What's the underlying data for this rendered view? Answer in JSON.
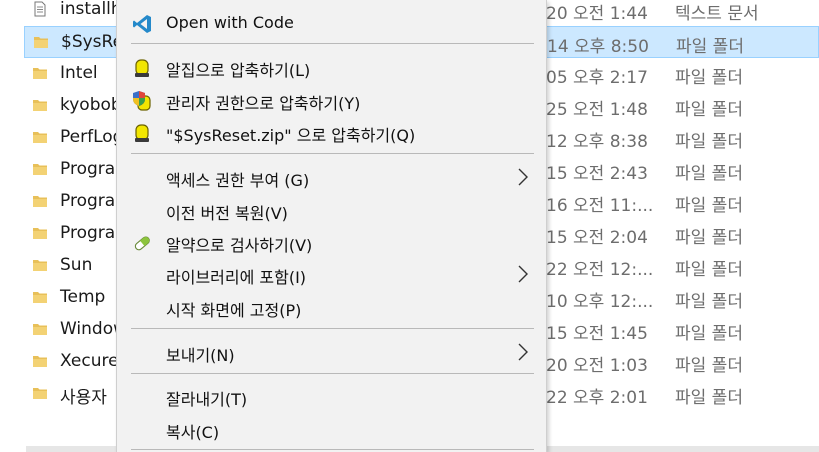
{
  "files": [
    {
      "name": "installh",
      "date": "20 오전 1:44",
      "type": "텍스트 문서",
      "icon": "text-document-icon",
      "selected": false
    },
    {
      "name": "$SysRe",
      "date": "14 오후 8:50",
      "type": "파일 폴더",
      "icon": "folder-icon",
      "selected": true
    },
    {
      "name": "Intel",
      "date": "05 오후 2:17",
      "type": "파일 폴더",
      "icon": "folder-icon",
      "selected": false
    },
    {
      "name": "kyobob",
      "date": "25 오전 1:48",
      "type": "파일 폴더",
      "icon": "folder-icon",
      "selected": false
    },
    {
      "name": "PerfLog",
      "date": "12 오후 8:38",
      "type": "파일 폴더",
      "icon": "folder-icon",
      "selected": false
    },
    {
      "name": "Prograr",
      "date": "15 오전 2:43",
      "type": "파일 폴더",
      "icon": "folder-icon",
      "selected": false
    },
    {
      "name": "Prograr",
      "date": "16 오전 11:...",
      "type": "파일 폴더",
      "icon": "folder-icon",
      "selected": false
    },
    {
      "name": "Prograr",
      "date": "15 오전 2:04",
      "type": "파일 폴더",
      "icon": "folder-icon",
      "selected": false
    },
    {
      "name": "Sun",
      "date": "22 오전 12:...",
      "type": "파일 폴더",
      "icon": "folder-icon",
      "selected": false
    },
    {
      "name": "Temp",
      "date": "10 오후 12:...",
      "type": "파일 폴더",
      "icon": "folder-icon",
      "selected": false
    },
    {
      "name": "Window",
      "date": "15 오전 1:45",
      "type": "파일 폴더",
      "icon": "folder-icon",
      "selected": false
    },
    {
      "name": "Xecure",
      "date": "20 오전 1:03",
      "type": "파일 폴더",
      "icon": "folder-icon",
      "selected": false
    },
    {
      "name": "사용자",
      "date": "22 오후 2:01",
      "type": "파일 폴더",
      "icon": "folder-icon",
      "selected": false
    }
  ],
  "context_menu": {
    "items": [
      {
        "label": "Open with Code",
        "icon": "vscode-icon",
        "submenu": false
      },
      {
        "label": "알집으로 압축하기(L)",
        "icon": "alzip-icon",
        "submenu": false
      },
      {
        "label": "관리자 권한으로 압축하기(Y)",
        "icon": "shield-icon",
        "submenu": false
      },
      {
        "label": "\"$SysReset.zip\" 으로 압축하기(Q)",
        "icon": "alzip-icon",
        "submenu": false
      },
      {
        "label": "액세스 권한 부여 (G)",
        "icon": "",
        "submenu": true
      },
      {
        "label": "이전 버전 복원(V)",
        "icon": "",
        "submenu": false
      },
      {
        "label": "알약으로 검사하기(V)",
        "icon": "alyac-pill-icon",
        "submenu": false
      },
      {
        "label": "라이브러리에 포함(I)",
        "icon": "",
        "submenu": true
      },
      {
        "label": "시작 화면에 고정(P)",
        "icon": "",
        "submenu": false
      },
      {
        "label": "보내기(N)",
        "icon": "",
        "submenu": true
      },
      {
        "label": "잘라내기(T)",
        "icon": "",
        "submenu": false
      },
      {
        "label": "복사(C)",
        "icon": "",
        "submenu": false
      }
    ]
  },
  "colors": {
    "selection_bg": "#cce8ff",
    "menu_bg": "#f2f2f2",
    "folder": "#e8c059",
    "vscode": "#2489ca",
    "alzip": "#f2e600"
  }
}
